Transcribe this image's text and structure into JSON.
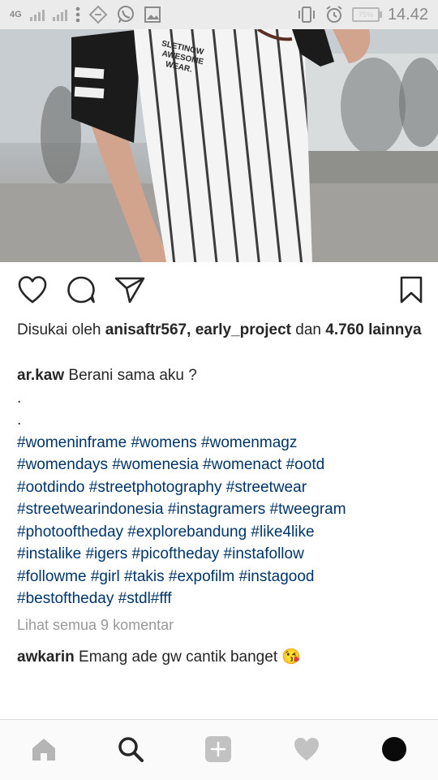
{
  "status_bar": {
    "network": "4G",
    "battery_percent": "75%",
    "time": "14.42",
    "icons": [
      "signal-icon",
      "more-icon",
      "data-saver-icon",
      "whatsapp-icon",
      "gallery-icon",
      "vibrate-icon",
      "alarm-icon",
      "battery-icon"
    ]
  },
  "post": {
    "actions": {
      "icons": [
        "heart-icon",
        "comment-icon",
        "share-icon",
        "bookmark-icon"
      ]
    },
    "likes": {
      "prefix": "Disukai oleh",
      "user1": "anisaftr567",
      "sep": ",",
      "user2": "early_project",
      "conj": "dan",
      "count": "4.760",
      "suffix": "lainnya"
    },
    "caption": {
      "user": "ar.kaw",
      "text": "Berani sama aku ?",
      "dot1": ".",
      "dot2": ".",
      "hashtags": [
        "#womeninframe #womens #womenmagz",
        "#womendays #womenesia #womenact #ootd",
        "#ootdindo #streetphotography #streetwear",
        "#streetwearindonesia #instagramers #tweegram",
        "#photooftheday #explorebandung #like4like",
        "#instalike #igers #picoftheday #instafollow",
        "#followme #girl #takis #expofilm #instagood",
        "#bestoftheday #stdl#fff"
      ]
    },
    "view_all_comments": "Lihat semua 9 komentar",
    "comment": {
      "user": "awkarin",
      "text": "Emang ade gw cantik banget",
      "emoji": "😘"
    }
  },
  "bottom_nav": {
    "icons": [
      "home-icon",
      "search-icon",
      "add-post-icon",
      "activity-heart-icon",
      "profile-avatar"
    ],
    "active": "search-icon"
  },
  "colors": {
    "hashtag": "#003569",
    "muted": "#999999",
    "text": "#262626",
    "status_bar_bg": "#ebebeb"
  }
}
